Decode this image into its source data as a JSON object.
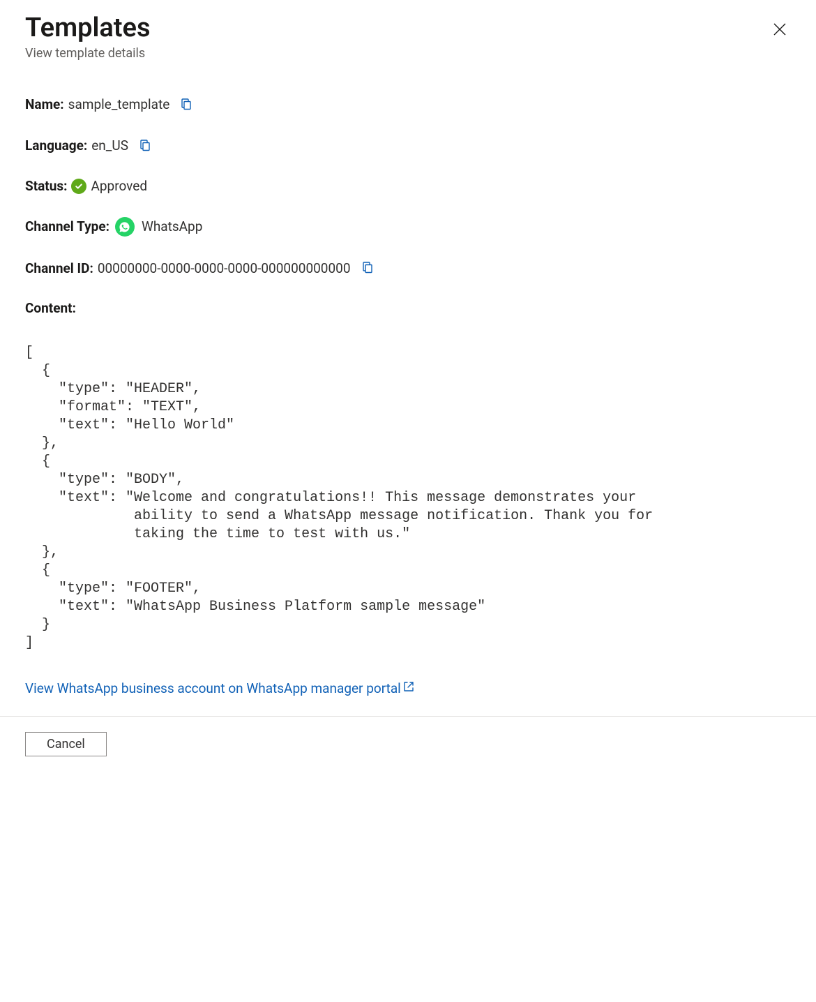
{
  "header": {
    "title": "Templates",
    "subtitle": "View template details"
  },
  "labels": {
    "name": "Name:",
    "language": "Language:",
    "status": "Status:",
    "channel_type": "Channel Type:",
    "channel_id": "Channel ID:",
    "content": "Content:"
  },
  "values": {
    "name": "sample_template",
    "language": "en_US",
    "status": "Approved",
    "channel_type": "WhatsApp",
    "channel_id": "00000000-0000-0000-0000-000000000000"
  },
  "content_json": "[\n  {\n    \"type\": \"HEADER\",\n    \"format\": \"TEXT\",\n    \"text\": \"Hello World\"\n  },\n  {\n    \"type\": \"BODY\",\n    \"text\": \"Welcome and congratulations!! This message demonstrates your\n             ability to send a WhatsApp message notification. Thank you for\n             taking the time to test with us.\"\n  },\n  {\n    \"type\": \"FOOTER\",\n    \"text\": \"WhatsApp Business Platform sample message\"\n  }\n]",
  "link": {
    "text": "View WhatsApp business account on WhatsApp manager portal"
  },
  "footer": {
    "cancel": "Cancel"
  },
  "colors": {
    "link": "#0f60b6",
    "status_green": "#5fa919",
    "whatsapp_green": "#25d366"
  }
}
